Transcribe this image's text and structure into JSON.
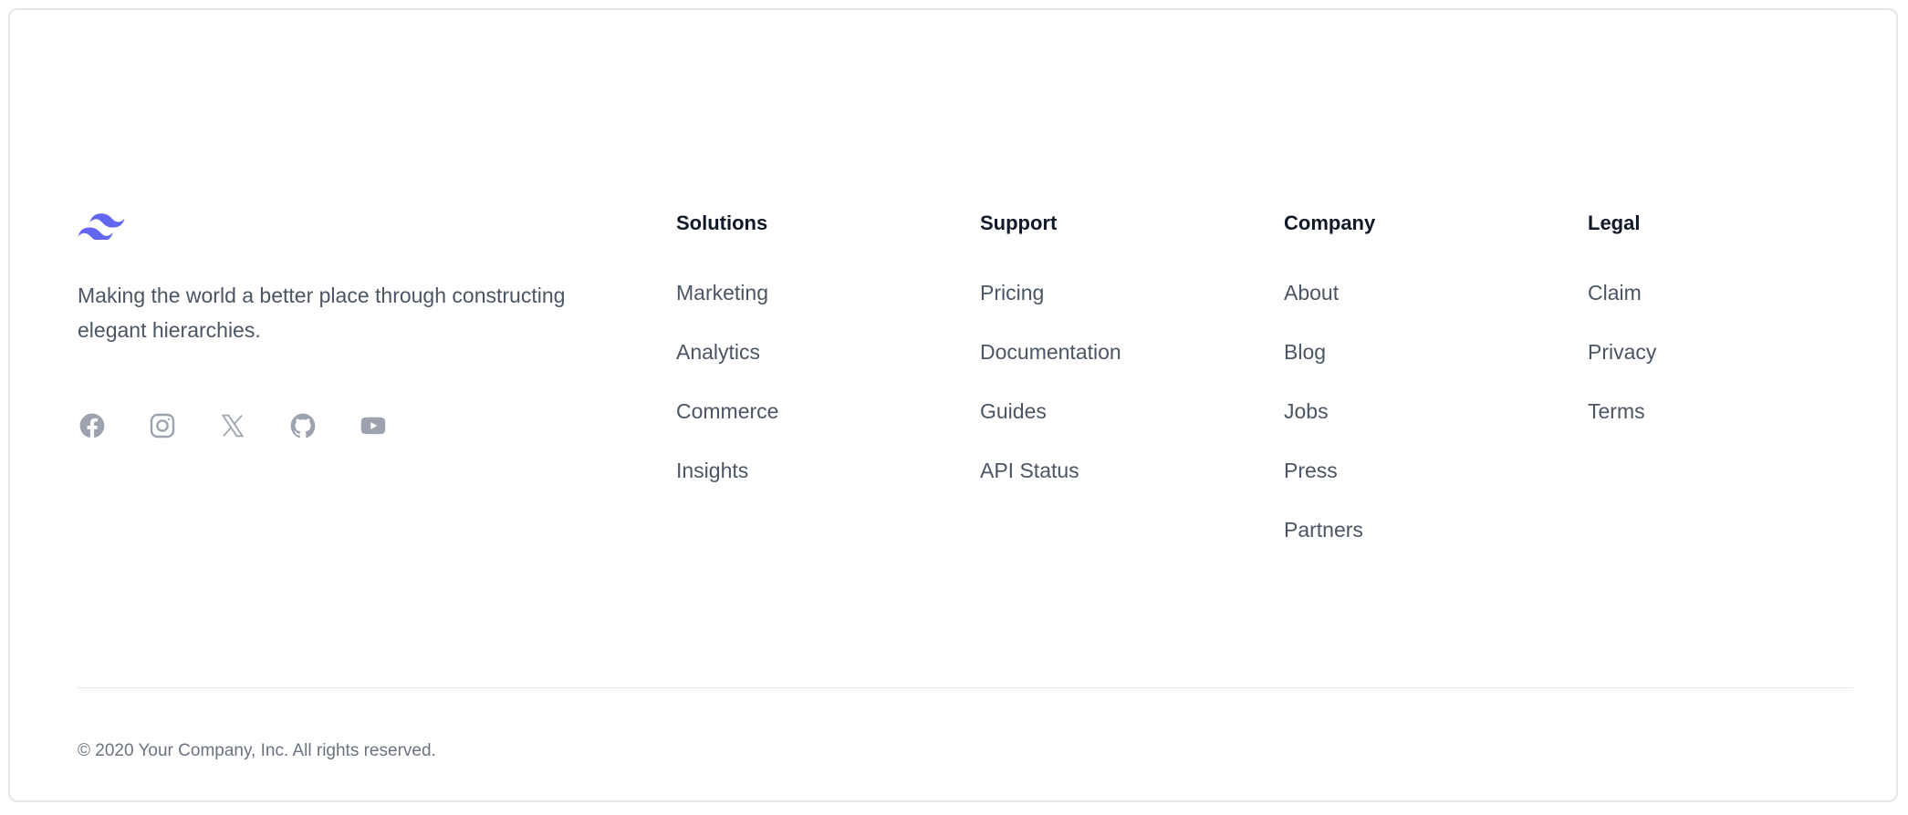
{
  "brand": {
    "logo_icon": "tailwind-wave-logo",
    "accent_color": "#6366f1",
    "tagline": "Making the world a better place through constructing elegant hierarchies."
  },
  "socials": [
    {
      "name": "Facebook",
      "icon": "facebook-icon"
    },
    {
      "name": "Instagram",
      "icon": "instagram-icon"
    },
    {
      "name": "X",
      "icon": "x-icon"
    },
    {
      "name": "GitHub",
      "icon": "github-icon"
    },
    {
      "name": "YouTube",
      "icon": "youtube-icon"
    }
  ],
  "columns": [
    {
      "title": "Solutions",
      "links": [
        "Marketing",
        "Analytics",
        "Commerce",
        "Insights"
      ]
    },
    {
      "title": "Support",
      "links": [
        "Pricing",
        "Documentation",
        "Guides",
        "API Status"
      ]
    },
    {
      "title": "Company",
      "links": [
        "About",
        "Blog",
        "Jobs",
        "Press",
        "Partners"
      ]
    },
    {
      "title": "Legal",
      "links": [
        "Claim",
        "Privacy",
        "Terms"
      ]
    }
  ],
  "footer": {
    "copyright": "© 2020 Your Company, Inc. All rights reserved."
  }
}
